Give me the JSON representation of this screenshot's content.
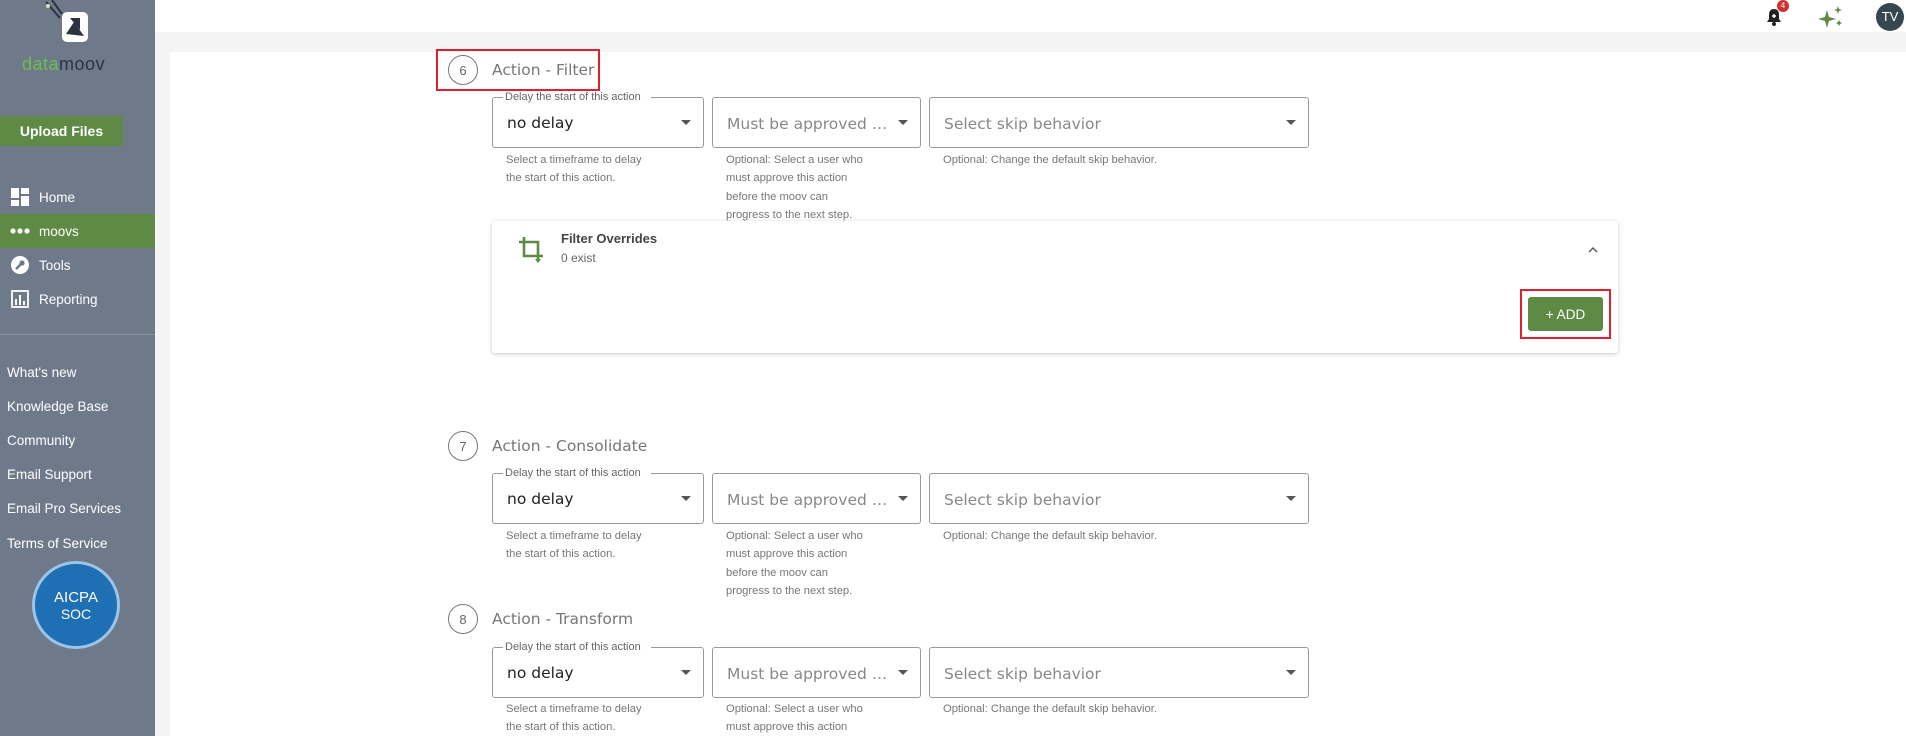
{
  "brand": {
    "logo_prefix": "data",
    "logo_suffix": "moov",
    "accent": "#5e8a45",
    "sidebar_bg": "#6e7a8a",
    "highlight": "#e0202d"
  },
  "sidebar": {
    "upload_label": "Upload Files",
    "nav": [
      {
        "label": "Home",
        "icon": "dashboard-icon"
      },
      {
        "label": "moovs",
        "icon": "dots-icon",
        "active": true
      },
      {
        "label": "Tools",
        "icon": "wrench-icon"
      },
      {
        "label": "Reporting",
        "icon": "bar-chart-icon"
      }
    ],
    "links": [
      "What's new",
      "Knowledge Base",
      "Community",
      "Email Support",
      "Email Pro Services",
      "Terms of Service"
    ],
    "badge": {
      "line1": "AICPA",
      "line2": "SOC"
    }
  },
  "topbar": {
    "notification_count": "4",
    "avatar_initials": "TV"
  },
  "common": {
    "delay_legend": "Delay the start of this action",
    "delay_value": "no delay",
    "delay_help_1": "Select a timeframe to delay",
    "delay_help_2": "the start of this action.",
    "approve_placeholder": "Must be approved …",
    "approve_help_1": "Optional: Select a user who",
    "approve_help_2": "must approve this action",
    "approve_help_3": "before the moov can",
    "approve_help_4": "progress to the next step.",
    "skip_placeholder": "Select skip behavior",
    "skip_help": "Optional: Change the default skip behavior."
  },
  "steps": [
    {
      "number": "6",
      "title": "Action - Filter"
    },
    {
      "number": "7",
      "title": "Action - Consolidate"
    },
    {
      "number": "8",
      "title": "Action - Transform"
    }
  ],
  "filter_overrides": {
    "title": "Filter Overrides",
    "subtitle": "0 exist",
    "add_label": "+ ADD"
  }
}
